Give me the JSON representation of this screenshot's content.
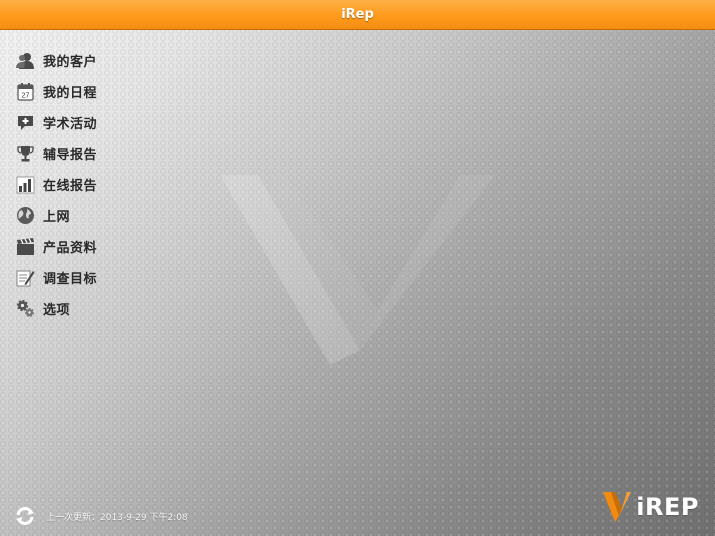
{
  "header": {
    "title": "iRep"
  },
  "menu": {
    "items": [
      {
        "label": "我的客户",
        "icon": "customers-icon"
      },
      {
        "label": "我的日程",
        "icon": "calendar-icon"
      },
      {
        "label": "学术活动",
        "icon": "academic-event-icon"
      },
      {
        "label": "辅导报告",
        "icon": "trophy-icon"
      },
      {
        "label": "在线报告",
        "icon": "bar-chart-icon"
      },
      {
        "label": "上网",
        "icon": "globe-icon"
      },
      {
        "label": "产品资料",
        "icon": "clapperboard-icon"
      },
      {
        "label": "调查目标",
        "icon": "survey-icon"
      },
      {
        "label": "选项",
        "icon": "gears-icon"
      }
    ],
    "calendar_day": "27"
  },
  "footer": {
    "last_update": "上一次更新：2013-9-29 下午2:08",
    "brand": "iREP"
  },
  "colors": {
    "accent": "#ff9a1d",
    "brand_mark": "#f08a10"
  }
}
